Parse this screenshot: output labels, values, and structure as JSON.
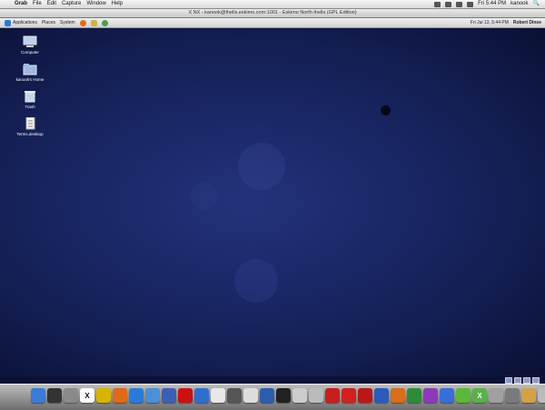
{
  "menubar": {
    "apple": "",
    "app_name": "Grab",
    "items": [
      "File",
      "Edit",
      "Capture",
      "Window",
      "Help"
    ],
    "clock": "Fri 5:44 PM",
    "user": "kanook"
  },
  "window": {
    "title": "X  NX - kanook@thells.eskimo.com:1001 - Eskimo North thells (GPL Edition)"
  },
  "panel": {
    "menus": [
      "Applications",
      "Places",
      "System"
    ],
    "clock": "Fri Jul 13, 5:44 PM",
    "user": "Robert Dinse"
  },
  "desktop": {
    "icons": [
      {
        "label": "Computer",
        "name": "computer-icon"
      },
      {
        "label": "kanook's Home",
        "name": "home-folder-icon"
      },
      {
        "label": "Trash",
        "name": "trash-icon"
      },
      {
        "label": "Terms.desktop",
        "name": "document-icon"
      }
    ]
  },
  "colors": {
    "desktop": "#1a2868",
    "menubar": "#e6e6e6",
    "dock": "#9a9a9a"
  },
  "dock": {
    "items": [
      {
        "name": "finder-icon",
        "color": "#3a7bd5",
        "glyph": ""
      },
      {
        "name": "dashboard-icon",
        "color": "#333333",
        "glyph": ""
      },
      {
        "name": "system-prefs-icon",
        "color": "#8a8a8a",
        "glyph": ""
      },
      {
        "name": "x11-icon",
        "color": "#ffffff",
        "glyph": "X"
      },
      {
        "name": "ring-app-icon",
        "color": "#d6b400",
        "glyph": ""
      },
      {
        "name": "firefox-icon",
        "color": "#e06a1a",
        "glyph": ""
      },
      {
        "name": "safari-icon",
        "color": "#2a7ad8",
        "glyph": ""
      },
      {
        "name": "mail-icon",
        "color": "#4a90d9",
        "glyph": ""
      },
      {
        "name": "thunderbird-icon",
        "color": "#3b5fb3",
        "glyph": ""
      },
      {
        "name": "opera-icon",
        "color": "#cc1111",
        "glyph": ""
      },
      {
        "name": "itunes-icon",
        "color": "#2f6ecf",
        "glyph": ""
      },
      {
        "name": "ical-icon",
        "color": "#e8e8e8",
        "glyph": ""
      },
      {
        "name": "preview-icon",
        "color": "#555555",
        "glyph": ""
      },
      {
        "name": "search-icon",
        "color": "#dddddd",
        "glyph": ""
      },
      {
        "name": "grid-icon",
        "color": "#2d5db0",
        "glyph": ""
      },
      {
        "name": "terminal-icon",
        "color": "#222222",
        "glyph": ""
      },
      {
        "name": "grab-icon",
        "color": "#cccccc",
        "glyph": ""
      },
      {
        "name": "tool-icon",
        "color": "#bbbbbb",
        "glyph": ""
      },
      {
        "name": "red-app-icon",
        "color": "#c81e1e",
        "glyph": ""
      },
      {
        "name": "red-app-2-icon",
        "color": "#d22020",
        "glyph": ""
      },
      {
        "name": "red-app-3-icon",
        "color": "#b81818",
        "glyph": ""
      },
      {
        "name": "blue-app-icon",
        "color": "#2c5bb8",
        "glyph": ""
      },
      {
        "name": "paint-icon",
        "color": "#d86d1a",
        "glyph": ""
      },
      {
        "name": "globe-icon",
        "color": "#2d8c3a",
        "glyph": ""
      },
      {
        "name": "purple-app-icon",
        "color": "#8a3ab8",
        "glyph": ""
      },
      {
        "name": "network-icon",
        "color": "#3a6ed6",
        "glyph": ""
      },
      {
        "name": "green-app-icon",
        "color": "#5cb83a",
        "glyph": ""
      },
      {
        "name": "x11-terminal-icon",
        "color": "#5ab04a",
        "glyph": "X"
      },
      {
        "name": "gray-app-icon",
        "color": "#a0a0a0",
        "glyph": ""
      },
      {
        "name": "stack-icon",
        "color": "#7a7a7a",
        "glyph": ""
      },
      {
        "name": "folder-icon",
        "color": "#d4a048",
        "glyph": ""
      },
      {
        "name": "downloads-icon",
        "color": "#bbbbbb",
        "glyph": ""
      },
      {
        "name": "trash-dock-icon",
        "color": "#e0e0e0",
        "glyph": ""
      }
    ]
  }
}
